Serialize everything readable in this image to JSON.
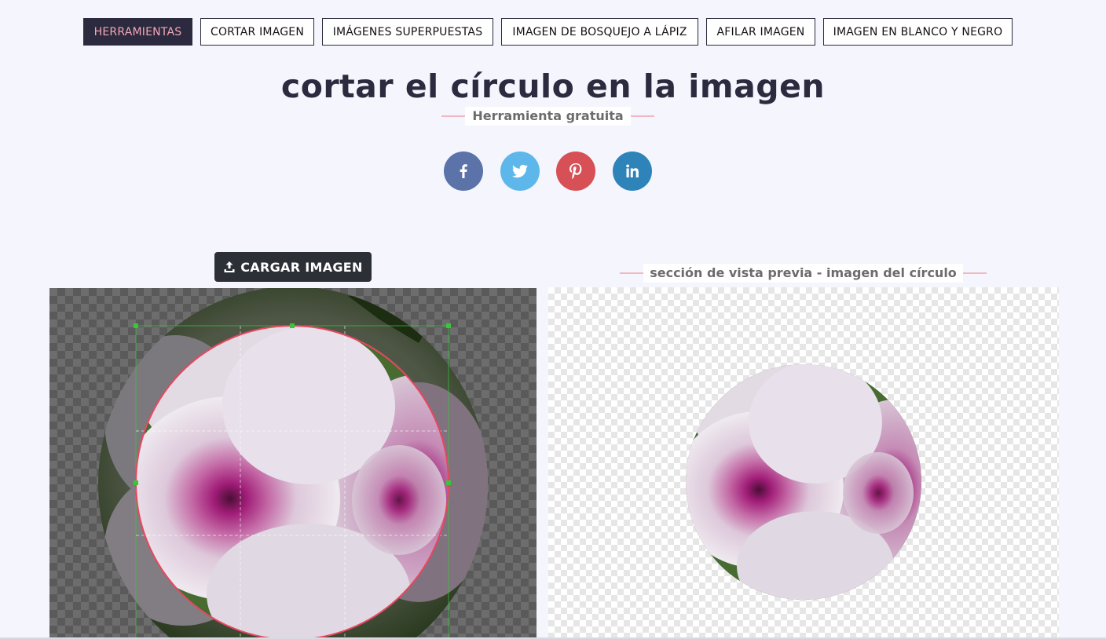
{
  "nav": {
    "items": [
      {
        "label": "HERRAMIENTAS",
        "active": true
      },
      {
        "label": "CORTAR IMAGEN",
        "active": false
      },
      {
        "label": "IMÁGENES SUPERPUESTAS",
        "active": false
      },
      {
        "label": "IMAGEN DE BOSQUEJO A LÁPIZ",
        "active": false
      },
      {
        "label": "AFILAR IMAGEN",
        "active": false
      },
      {
        "label": "IMAGEN EN BLANCO Y NEGRO",
        "active": false
      }
    ]
  },
  "header": {
    "title": "cortar el círculo en la imagen",
    "subtitle": "Herramienta gratuita"
  },
  "social": [
    {
      "name": "facebook-icon",
      "color": "#5b73a8"
    },
    {
      "name": "twitter-icon",
      "color": "#5eb7ea"
    },
    {
      "name": "pinterest-icon",
      "color": "#d65056"
    },
    {
      "name": "linkedin-icon",
      "color": "#2e84b8"
    }
  ],
  "editor": {
    "upload_label": "CARGAR IMAGEN"
  },
  "preview": {
    "label": "sección de vista previa - imagen del círculo"
  },
  "colors": {
    "accent_dark": "#2c2a3f",
    "accent_pink": "#f2a7b6",
    "crop_circle": "#e8475f",
    "crop_handle": "#39c739"
  }
}
